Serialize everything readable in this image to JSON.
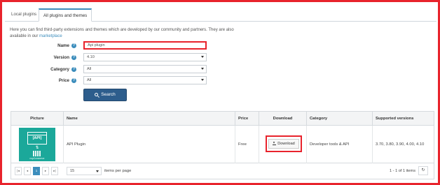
{
  "tabs": [
    {
      "label": "Local plugins",
      "active": false
    },
    {
      "label": "All plugins and themes",
      "active": true
    }
  ],
  "intro": {
    "text": "Here you can find third-party extensions and themes which are developed by our community and partners. They are also available in our",
    "link": "marketplace"
  },
  "form": {
    "name": {
      "label": "Name",
      "value": "Api plugin"
    },
    "version": {
      "label": "Version",
      "value": "4.10"
    },
    "category": {
      "label": "Category",
      "value": "All"
    },
    "price": {
      "label": "Price",
      "value": "All"
    },
    "help_icon": "?",
    "search_label": "Search"
  },
  "table": {
    "headers": [
      "Picture",
      "Name",
      "Price",
      "Download",
      "Category",
      "Supported versions"
    ],
    "rows": [
      {
        "thumb_title": "[API]",
        "thumb_caption": "nopCommerce",
        "name": "API Plugin",
        "price": "Free",
        "download_label": "Download",
        "category": "Developer tools & API",
        "versions": "3.70, 3.80, 3.90, 4.00, 4.10"
      }
    ]
  },
  "pager": {
    "first": "|◂",
    "prev": "◂",
    "current": "1",
    "next": "▸",
    "last": "▸|",
    "page_size": "15",
    "page_size_suffix": "items per page",
    "count_text": "1 - 1 of 1 items",
    "refresh_icon": "↻"
  },
  "colors": {
    "highlight": "#e8232c",
    "accent": "#3c8dbc",
    "button": "#2d5d8c",
    "thumb": "#1ba89a"
  }
}
